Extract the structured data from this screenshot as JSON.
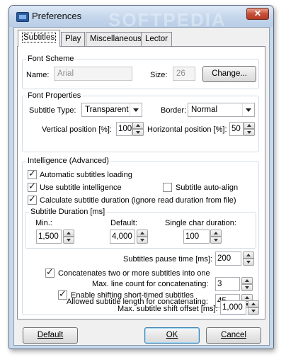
{
  "window": {
    "title": "Preferences",
    "close_glyph": "✕",
    "watermark": "SOFTPEDIA"
  },
  "tabs": [
    {
      "label": "Subtitles",
      "active": true
    },
    {
      "label": "Play",
      "active": false
    },
    {
      "label": "Miscellaneous",
      "active": false
    },
    {
      "label": "Lector",
      "active": false
    }
  ],
  "font_scheme": {
    "legend": "Font Scheme",
    "name_label": "Name:",
    "name_value": "Arial",
    "size_label": "Size:",
    "size_value": "26",
    "change_button": "Change..."
  },
  "font_properties": {
    "legend": "Font Properties",
    "subtitle_type_label": "Subtitle Type:",
    "subtitle_type_value": "Transparent",
    "border_label": "Border:",
    "border_value": "Normal",
    "vpos_label": "Vertical position [%]:",
    "vpos_value": "100",
    "hpos_label": "Horizontal position [%]:",
    "hpos_value": "50"
  },
  "intelligence": {
    "legend": "Intelligence (Advanced)",
    "auto_loading": {
      "label": "Automatic subtitles loading",
      "checked": true
    },
    "use_intelligence": {
      "label": "Use subtitle intelligence",
      "checked": true
    },
    "auto_align": {
      "label": "Subtitle auto-align",
      "checked": false
    },
    "calc_duration": {
      "label": "Calculate subtitle duration (ignore read duration from file)",
      "checked": true
    },
    "duration": {
      "legend": "Subtitle Duration [ms]",
      "min_label": "Min.:",
      "min_value": "1,500",
      "default_label": "Default:",
      "default_value": "4,000",
      "single_char_label": "Single char duration:",
      "single_char_value": "100"
    },
    "pause_label": "Subtitles pause time [ms]:",
    "pause_value": "200",
    "concat": {
      "label": "Concatenates two or more subtitles into one",
      "checked": true
    },
    "max_line_label": "Max. line count for concatenating:",
    "max_line_value": "3",
    "allowed_len_label": "Allowed subtitle length for concatenating:",
    "allowed_len_value": "45",
    "shift": {
      "label": "Enable shifting short-timed subtitles",
      "checked": true
    },
    "max_shift_label": "Max. subtitle shift offset [ms]:",
    "max_shift_value": "1,000"
  },
  "footer": {
    "default_button": "Default",
    "ok_button": "OK",
    "cancel_button": "Cancel"
  },
  "colors": {
    "titlebar": "#c4d6ec",
    "panel": "#ffffff",
    "group_border": "#d5dfe5"
  },
  "icons": {
    "app": "app-icon",
    "close": "close-icon",
    "spin_up": "spin-up-icon",
    "spin_down": "spin-down-icon",
    "dropdown": "dropdown-arrow-icon"
  }
}
